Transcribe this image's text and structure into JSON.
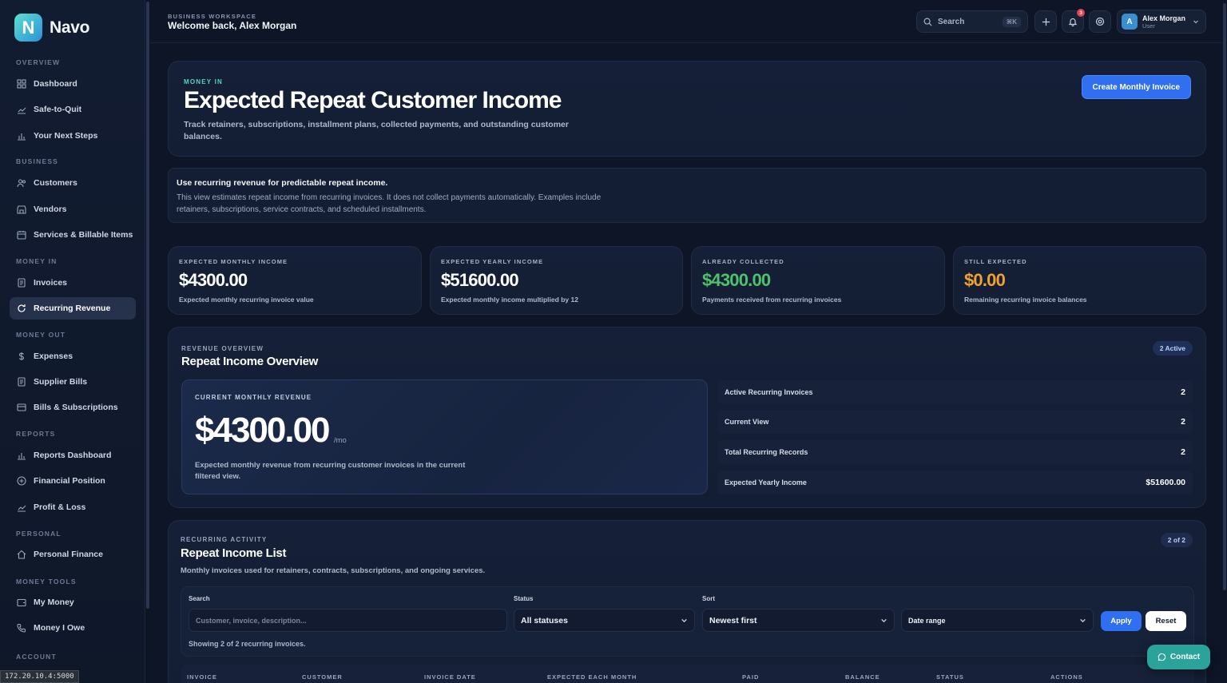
{
  "brand": {
    "logo_letter": "N",
    "name": "Navo"
  },
  "sidebar": {
    "sections": [
      {
        "label": "OVERVIEW",
        "items": [
          {
            "label": "Dashboard",
            "icon": "grid-icon"
          },
          {
            "label": "Safe-to-Quit",
            "icon": "trend-icon"
          },
          {
            "label": "Your Next Steps",
            "icon": "bar-chart-icon"
          }
        ]
      },
      {
        "label": "BUSINESS",
        "items": [
          {
            "label": "Customers",
            "icon": "users-icon"
          },
          {
            "label": "Vendors",
            "icon": "store-icon"
          },
          {
            "label": "Services & Billable Items",
            "icon": "box-icon"
          }
        ]
      },
      {
        "label": "MONEY IN",
        "items": [
          {
            "label": "Invoices",
            "icon": "document-icon"
          },
          {
            "label": "Recurring Revenue",
            "icon": "recurring-icon",
            "active": true
          }
        ]
      },
      {
        "label": "MONEY OUT",
        "items": [
          {
            "label": "Expenses",
            "icon": "dollar-icon"
          },
          {
            "label": "Supplier Bills",
            "icon": "document-icon"
          },
          {
            "label": "Bills & Subscriptions",
            "icon": "card-icon"
          }
        ]
      },
      {
        "label": "REPORTS",
        "items": [
          {
            "label": "Reports Dashboard",
            "icon": "bar-chart-icon"
          },
          {
            "label": "Financial Position",
            "icon": "circle-plus-icon"
          },
          {
            "label": "Profit & Loss",
            "icon": "trend-icon"
          }
        ]
      },
      {
        "label": "PERSONAL",
        "items": [
          {
            "label": "Personal Finance",
            "icon": "home-icon"
          }
        ]
      },
      {
        "label": "MONEY TOOLS",
        "items": [
          {
            "label": "My Money",
            "icon": "wallet-icon"
          },
          {
            "label": "Money I Owe",
            "icon": "phone-icon"
          }
        ]
      },
      {
        "label": "ACCOUNT",
        "items": []
      }
    ]
  },
  "status_bar": {
    "url": "172.20.10.4:5000"
  },
  "header": {
    "workspace_label": "BUSINESS WORKSPACE",
    "welcome": "Welcome back, Alex Morgan",
    "search_label": "Search",
    "search_shortcut": "⌘K",
    "notification_count": "3",
    "user": {
      "initial": "A",
      "name": "Alex Morgan",
      "role": "User"
    }
  },
  "hero": {
    "eyebrow": "MONEY IN",
    "title": "Expected Repeat Customer Income",
    "description": "Track retainers, subscriptions, installment plans, collected payments, and outstanding customer balances.",
    "cta": "Create Monthly Invoice"
  },
  "info": {
    "title": "Use recurring revenue for predictable repeat income.",
    "description": "This view estimates repeat income from recurring invoices. It does not collect payments automatically. Examples include retainers, subscriptions, service contracts, and scheduled installments."
  },
  "stats": [
    {
      "label": "EXPECTED MONTHLY INCOME",
      "value": "$4300.00",
      "sub": "Expected monthly recurring invoice value",
      "color": "#ffffff"
    },
    {
      "label": "EXPECTED YEARLY INCOME",
      "value": "$51600.00",
      "sub": "Expected monthly income multiplied by 12",
      "color": "#ffffff"
    },
    {
      "label": "ALREADY COLLECTED",
      "value": "$4300.00",
      "sub": "Payments received from recurring invoices",
      "color": "#4cc36a"
    },
    {
      "label": "STILL EXPECTED",
      "value": "$0.00",
      "sub": "Remaining recurring invoice balances",
      "color": "#f0a22e"
    }
  ],
  "overview": {
    "eyebrow": "REVENUE OVERVIEW",
    "title": "Repeat Income Overview",
    "badge": "2 Active",
    "current_label": "CURRENT MONTHLY REVENUE",
    "current_value": "$4300.00",
    "current_unit": "/mo",
    "current_desc": "Expected monthly revenue from recurring customer invoices in the current filtered view.",
    "metrics": [
      {
        "label": "Active Recurring Invoices",
        "value": "2"
      },
      {
        "label": "Current View",
        "value": "2"
      },
      {
        "label": "Total Recurring Records",
        "value": "2"
      },
      {
        "label": "Expected Yearly Income",
        "value": "$51600.00"
      }
    ]
  },
  "list": {
    "eyebrow": "RECURRING ACTIVITY",
    "title": "Repeat Income List",
    "badge": "2 of 2",
    "description": "Monthly invoices used for retainers, contracts, subscriptions, and ongoing services.",
    "filters": {
      "search_label": "Search",
      "search_placeholder": "Customer, invoice, description...",
      "status_label": "Status",
      "status_value": "All statuses",
      "sort_label": "Sort",
      "sort_value": "Newest first",
      "date_value": "Date range",
      "apply": "Apply",
      "reset": "Reset"
    },
    "showing": "Showing 2 of 2 recurring invoices.",
    "columns": [
      "INVOICE",
      "CUSTOMER",
      "INVOICE DATE",
      "EXPECTED EACH MONTH",
      "PAID",
      "BALANCE",
      "STATUS",
      "ACTIONS"
    ]
  },
  "contact": {
    "label": "Contact"
  }
}
